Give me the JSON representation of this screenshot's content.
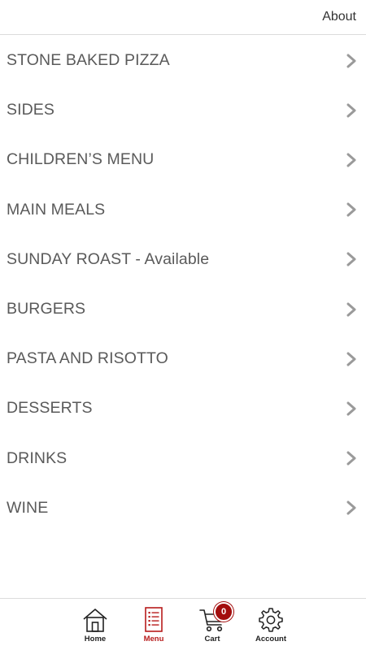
{
  "header": {
    "about_label": "About"
  },
  "menu": {
    "items": [
      {
        "label": "STONE BAKED PIZZA"
      },
      {
        "label": "SIDES"
      },
      {
        "label": "CHILDREN’S MENU"
      },
      {
        "label": "MAIN MEALS"
      },
      {
        "label": "SUNDAY ROAST - Available"
      },
      {
        "label": "BURGERS"
      },
      {
        "label": "PASTA AND RISOTTO"
      },
      {
        "label": "DESSERTS"
      },
      {
        "label": "DRINKS"
      },
      {
        "label": "WINE"
      }
    ],
    "chevron_icon": "chevron-right-icon"
  },
  "tabbar": {
    "home_label": "Home",
    "menu_label": "Menu",
    "cart_label": "Cart",
    "account_label": "Account",
    "cart_count": "0",
    "active_tab": "Menu",
    "accent_color": "#b71c1c"
  }
}
